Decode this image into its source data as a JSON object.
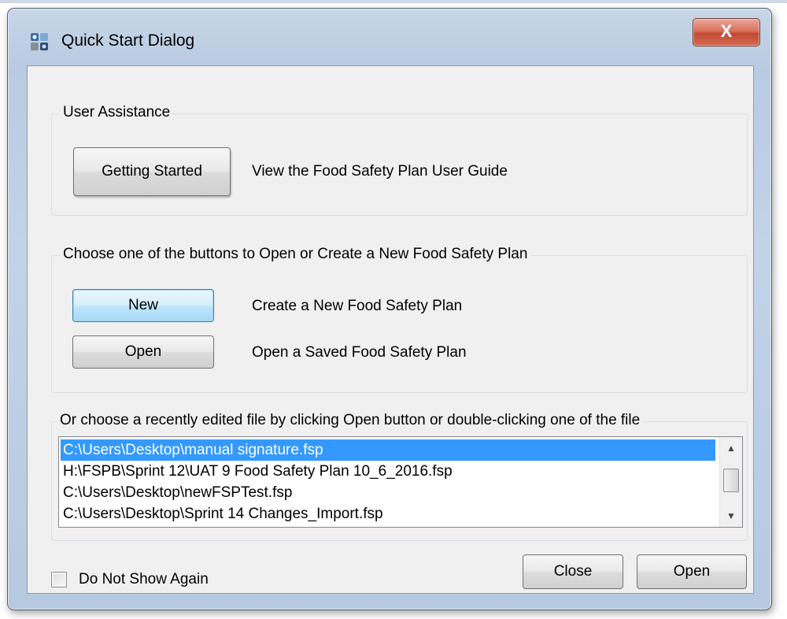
{
  "window": {
    "title": "Quick Start Dialog",
    "close_glyph": "X",
    "app_icon": "app-icon"
  },
  "user_assistance": {
    "group_label": "User Assistance",
    "getting_started_label": "Getting Started",
    "getting_started_desc": "View the Food Safety Plan User Guide"
  },
  "plan_actions": {
    "group_label": "Choose one of the buttons to Open or Create a New Food Safety Plan",
    "new_label": "New",
    "new_desc": "Create a New Food Safety Plan",
    "open_label": "Open",
    "open_desc": "Open a Saved Food Safety Plan"
  },
  "recent_files": {
    "group_label": "Or choose a recently edited file by clicking Open button or double-clicking one of the file",
    "items": [
      {
        "path": "C:\\Users\\Desktop\\manual signature.fsp",
        "selected": true
      },
      {
        "path": "H:\\FSPB\\Sprint 12\\UAT 9 Food Safety Plan 10_6_2016.fsp",
        "selected": false
      },
      {
        "path": "C:\\Users\\Desktop\\newFSPTest.fsp",
        "selected": false
      },
      {
        "path": "C:\\Users\\Desktop\\Sprint 14 Changes_Import.fsp",
        "selected": false
      }
    ]
  },
  "footer": {
    "do_not_show_label": "Do Not Show Again",
    "do_not_show_checked": false,
    "close_label": "Close",
    "open_label": "Open"
  },
  "colors": {
    "selection": "#3399ff",
    "close_button": "#c24a35",
    "client_background": "#f0f0f0"
  }
}
